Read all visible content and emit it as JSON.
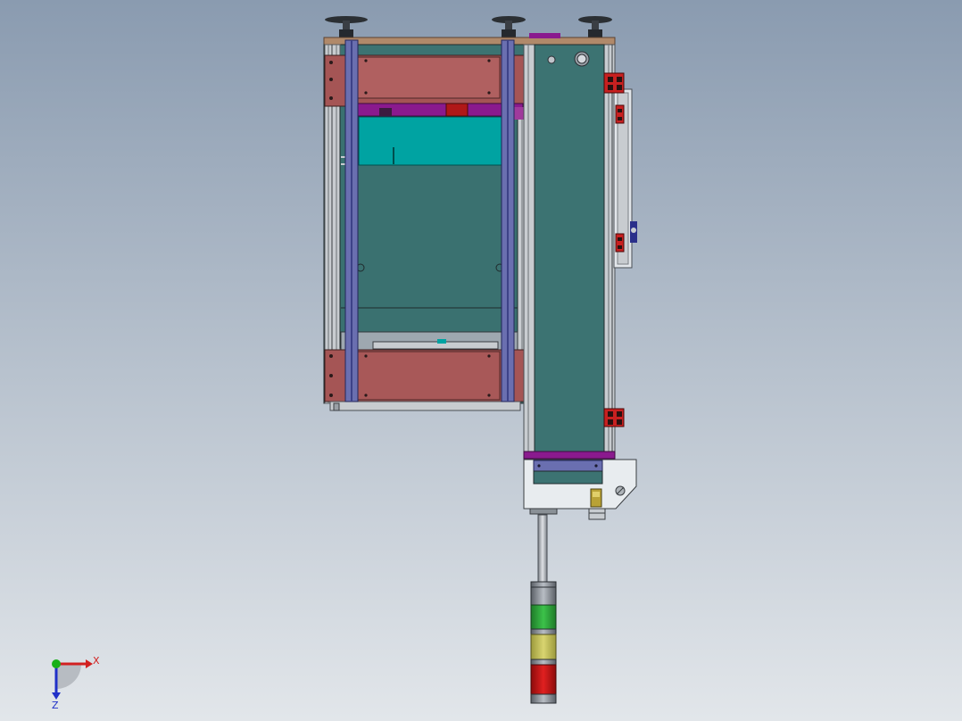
{
  "viewport": {
    "background_top": "#8a9bb0",
    "background_bottom": "#e2e6ea"
  },
  "colors": {
    "frame_teal": "#3c7372",
    "panel_salmon": "#a55555",
    "rail_blue": "#6a6fb0",
    "purple_strip": "#8a1a8e",
    "cyan_board": "#00a3a2",
    "wood_top": "#b0896a",
    "aluminum": "#c8ccd0",
    "bracket_red": "#c82020",
    "lamp_green": "#2ea83a",
    "lamp_yellow": "#c9c55a",
    "lamp_red": "#c81414",
    "axis_x": "#d22020",
    "axis_y": "#18b018",
    "axis_z": "#2030c8"
  },
  "triad": {
    "x_label": "X",
    "z_label": "Z"
  },
  "icons": {
    "triad": "coordinate-triad-icon",
    "foot": "leveling-foot-icon",
    "signal_tower": "signal-tower-lamp-icon"
  }
}
